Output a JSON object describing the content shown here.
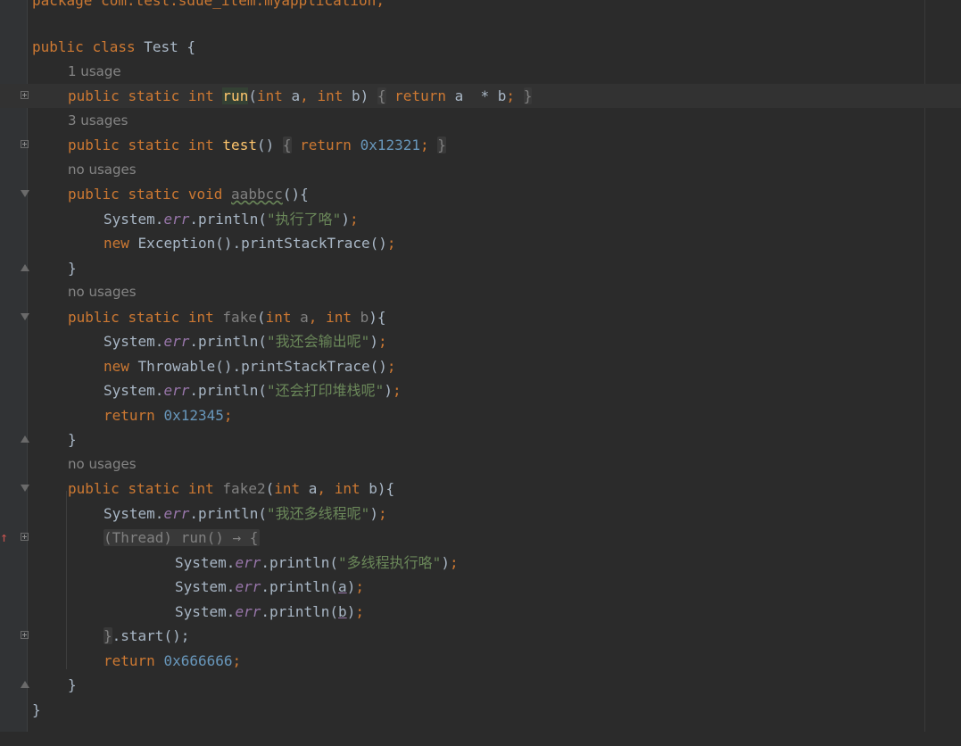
{
  "editor": {
    "package_line": "package com.test.sdue_item.myapplication;",
    "class_decl": {
      "kw1": "public",
      "kw2": "class",
      "name": "Test",
      "brace": "{"
    },
    "kw": {
      "public": "public",
      "static": "static",
      "int": "int",
      "void": "void",
      "return": "return",
      "new": "new"
    },
    "hints": {
      "one": "1 usage",
      "three": "3 usages",
      "none": "no usages"
    },
    "run": {
      "name": "run",
      "params_a": "a",
      "params_b": "b",
      "body": "a  * b"
    },
    "test": {
      "name": "test",
      "value": "0x12321"
    },
    "aabbcc": {
      "name": "aabbcc",
      "s1": "\"执行了咯\"",
      "exc": "Exception().printStackTrace()"
    },
    "fake": {
      "name": "fake",
      "s1": "\"我还会输出呢\"",
      "thr": "Throwable().printStackTrace()",
      "s2": "\"还会打印堆栈呢\"",
      "ret": "0x12345"
    },
    "fake2": {
      "name": "fake2",
      "s1": "\"我还多线程呢\"",
      "lambda": "(Thread) run() → {",
      "s2": "\"多线程执行咯\"",
      "start": ".start();",
      "ret": "0x666666"
    },
    "sys": "System.",
    "err": "err",
    "println": ".println(",
    "var_a": "a",
    "var_b": "b"
  }
}
